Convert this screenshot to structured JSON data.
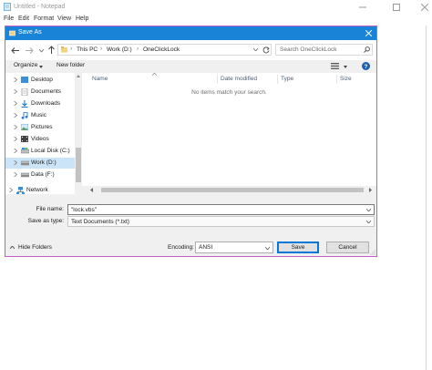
{
  "notepad": {
    "title": "Untitled - Notepad",
    "menu": [
      "File",
      "Edit",
      "Format",
      "View",
      "Help"
    ]
  },
  "dialog": {
    "title": "Save As",
    "address": {
      "segments": [
        "This PC",
        "Work (D:)",
        "OneClickLock"
      ]
    },
    "search_placeholder": "Search OneClickLock",
    "commands": {
      "organize": "Organize",
      "new_folder": "New folder"
    },
    "nav_items": [
      {
        "label": "Desktop",
        "icon": "desktop-folder-icon"
      },
      {
        "label": "Documents",
        "icon": "documents-folder-icon"
      },
      {
        "label": "Downloads",
        "icon": "downloads-folder-icon"
      },
      {
        "label": "Music",
        "icon": "music-folder-icon"
      },
      {
        "label": "Pictures",
        "icon": "pictures-folder-icon"
      },
      {
        "label": "Videos",
        "icon": "videos-folder-icon"
      },
      {
        "label": "Local Disk (C:)",
        "icon": "drive-icon"
      },
      {
        "label": "Work (D:)",
        "icon": "drive-icon",
        "selected": true
      },
      {
        "label": "Data (F:)",
        "icon": "drive-icon"
      },
      {
        "label": "Network",
        "icon": "network-icon"
      }
    ],
    "columns": [
      "Name",
      "Date modified",
      "Type",
      "Size"
    ],
    "empty_message": "No items match your search.",
    "file_name_label": "File name:",
    "file_name_value": "\"lock.vbs\"",
    "save_as_type_label": "Save as type:",
    "save_as_type_value": "Text Documents (*.txt)",
    "hide_folders": "Hide Folders",
    "encoding_label": "Encoding:",
    "encoding_value": "ANSI",
    "save_button": "Save",
    "cancel_button": "Cancel"
  },
  "colors": {
    "title_bar": "#1883d7",
    "selection": "#cce4f7",
    "dialog_border": "#c55fc7",
    "primary_button_border": "#0078d7"
  }
}
